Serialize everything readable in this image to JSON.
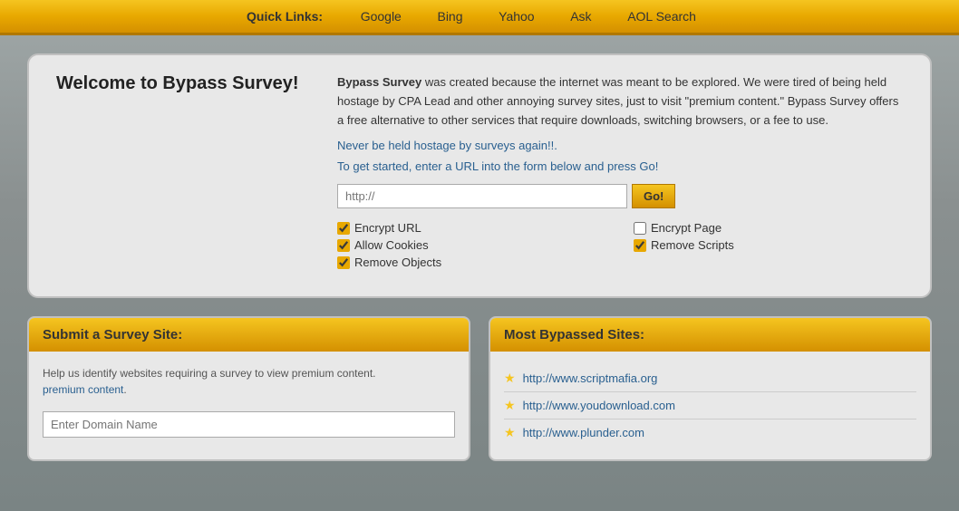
{
  "topbar": {
    "quicklinks_label": "Quick Links:",
    "links": [
      {
        "label": "Google",
        "url": "#"
      },
      {
        "label": "Bing",
        "url": "#"
      },
      {
        "label": "Yahoo",
        "url": "#"
      },
      {
        "label": "Ask",
        "url": "#"
      },
      {
        "label": "AOL Search",
        "url": "#"
      }
    ]
  },
  "welcome_card": {
    "title": "Welcome to Bypass Survey!",
    "description_part1": " was created because the internet was meant to be explored. We were tired of being held hostage by CPA Lead and other annoying survey sites, just to visit \"premium content.\" Bypass Survey offers a free alternative to other services that require downloads, switching browsers, or a fee to use.",
    "brand_name": "Bypass Survey",
    "never_held": "Never be held hostage by surveys again!!.",
    "get_started": "To get started, enter a URL into the form below and press Go!",
    "url_placeholder": "http://",
    "go_button": "Go!",
    "options": [
      {
        "label": "Encrypt URL",
        "checked": true,
        "id": "encrypt-url"
      },
      {
        "label": "Encrypt Page",
        "checked": false,
        "id": "encrypt-page"
      },
      {
        "label": "Allow Cookies",
        "checked": true,
        "id": "allow-cookies"
      },
      {
        "label": "Remove Scripts",
        "checked": true,
        "id": "remove-scripts"
      },
      {
        "label": "Remove Objects",
        "checked": true,
        "id": "remove-objects"
      }
    ]
  },
  "submit_card": {
    "header": "Submit a Survey Site:",
    "description": "Help us identify websites requiring a survey to view premium content.",
    "domain_placeholder": "Enter Domain Name"
  },
  "bypassed_card": {
    "header": "Most Bypassed Sites:",
    "sites": [
      {
        "label": "http://www.scriptmafia.org",
        "url": "#"
      },
      {
        "label": "http://www.youdownload.com",
        "url": "#"
      },
      {
        "label": "http://www.plunder.com",
        "url": "#"
      }
    ]
  }
}
